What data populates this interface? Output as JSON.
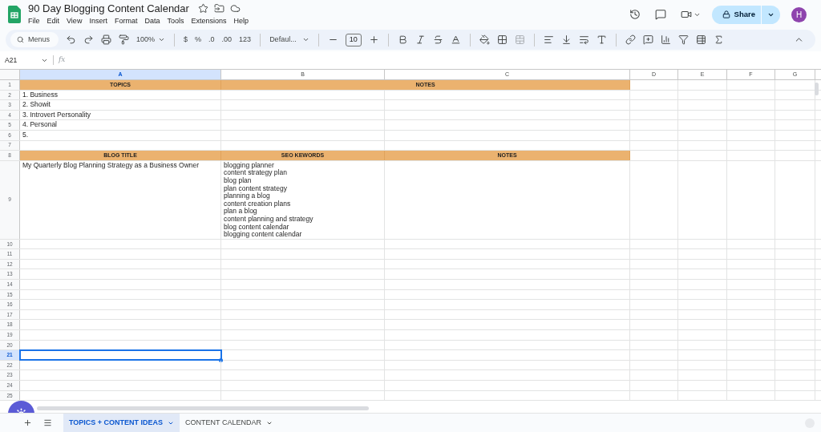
{
  "document": {
    "title": "90 Day Blogging Content Calendar"
  },
  "menu": [
    "File",
    "Edit",
    "View",
    "Insert",
    "Format",
    "Data",
    "Tools",
    "Extensions",
    "Help"
  ],
  "share": {
    "label": "Share"
  },
  "avatar": {
    "initial": "H"
  },
  "toolbar": {
    "search": "Menus",
    "zoom": "100%",
    "currency": "$",
    "percent": "%",
    "decrease_decimal": ".0",
    "increase_decimal": ".00",
    "number_format": "123",
    "font": "Defaul...",
    "font_size": "10"
  },
  "formula_bar": {
    "name_box": "A21",
    "fx": "fx"
  },
  "columns": [
    {
      "label": "A",
      "selected": true
    },
    {
      "label": "B",
      "selected": false
    },
    {
      "label": "C",
      "selected": false
    },
    {
      "label": "D",
      "selected": false
    },
    {
      "label": "E",
      "selected": false
    },
    {
      "label": "F",
      "selected": false
    },
    {
      "label": "G",
      "selected": false
    }
  ],
  "rows": [
    {
      "number": "1",
      "kind": "header",
      "merged": true,
      "selected": false,
      "cells": [
        "TOPICS",
        "NOTES"
      ]
    },
    {
      "number": "2",
      "kind": "data",
      "selected": false,
      "cells": [
        "1. Business"
      ]
    },
    {
      "number": "3",
      "kind": "data",
      "selected": false,
      "cells": [
        "2. Showit"
      ]
    },
    {
      "number": "4",
      "kind": "data",
      "selected": false,
      "cells": [
        "3. Introvert Personality"
      ]
    },
    {
      "number": "5",
      "kind": "data",
      "selected": false,
      "cells": [
        "4. Personal"
      ]
    },
    {
      "number": "6",
      "kind": "data",
      "selected": false,
      "cells": [
        "5."
      ]
    },
    {
      "number": "7",
      "kind": "data",
      "selected": false
    },
    {
      "number": "8",
      "kind": "header",
      "merged": false,
      "selected": false,
      "cells": [
        "BLOG TITLE",
        "SEO KEWORDS",
        "NOTES"
      ]
    },
    {
      "number": "9",
      "kind": "data",
      "selected": false,
      "cells": [
        "My Quarterly Blog Planning Strategy as a Business Owner",
        "blogging planner\ncontent strategy plan\nblog plan\nplan content strategy\nplanning a blog\ncontent creation plans\nplan a blog\ncontent planning and strategy\nblog content calendar\nblogging content calendar"
      ]
    },
    {
      "number": "10",
      "kind": "data",
      "selected": false
    },
    {
      "number": "11",
      "kind": "data",
      "selected": false
    },
    {
      "number": "12",
      "kind": "data",
      "selected": false
    },
    {
      "number": "13",
      "kind": "data",
      "selected": false
    },
    {
      "number": "14",
      "kind": "data",
      "selected": false
    },
    {
      "number": "15",
      "kind": "data",
      "selected": false
    },
    {
      "number": "16",
      "kind": "data",
      "selected": false
    },
    {
      "number": "17",
      "kind": "data",
      "selected": false
    },
    {
      "number": "18",
      "kind": "data",
      "selected": false
    },
    {
      "number": "19",
      "kind": "data",
      "selected": false
    },
    {
      "number": "20",
      "kind": "data",
      "selected": false
    },
    {
      "number": "21",
      "kind": "data",
      "selected": true
    },
    {
      "number": "22",
      "kind": "data",
      "selected": false
    },
    {
      "number": "23",
      "kind": "data",
      "selected": false
    },
    {
      "number": "24",
      "kind": "data",
      "selected": false
    },
    {
      "number": "25",
      "kind": "data",
      "selected": false
    }
  ],
  "sheets": [
    {
      "label": "TOPICS + CONTENT IDEAS",
      "selected": true
    },
    {
      "label": "CONTENT CALENDAR",
      "selected": false
    }
  ]
}
